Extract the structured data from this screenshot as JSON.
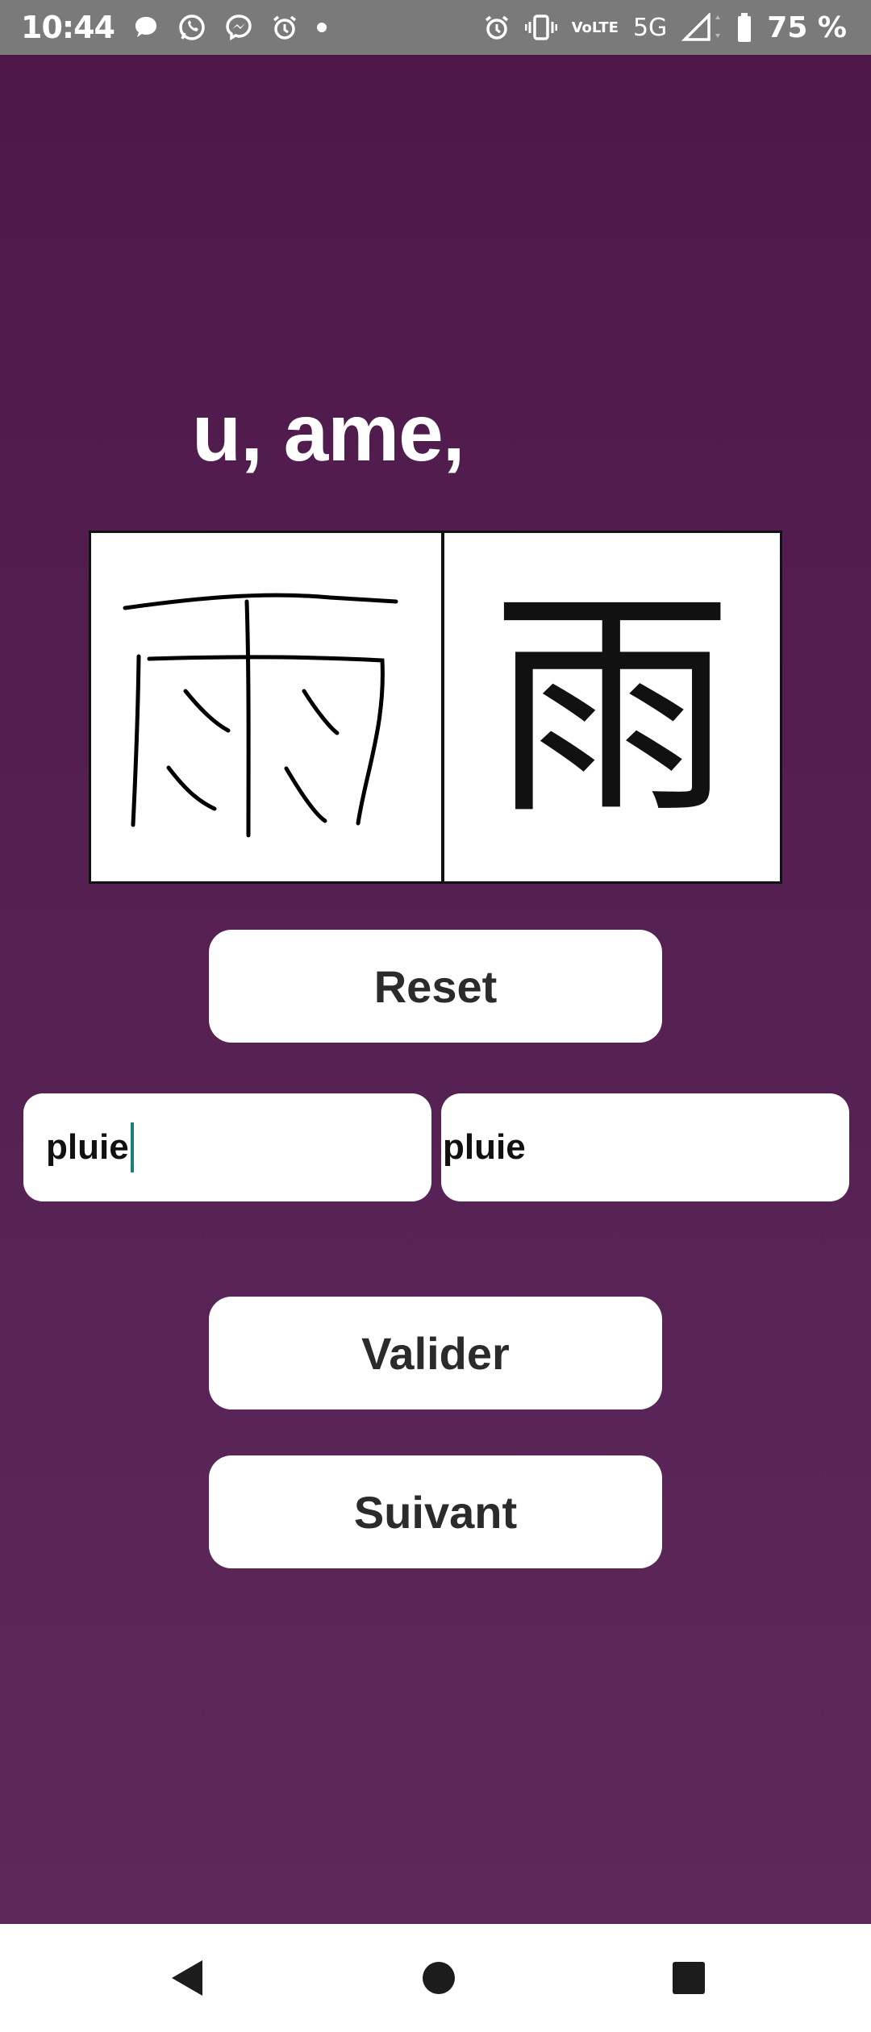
{
  "status_bar": {
    "time": "10:44",
    "network": "5G",
    "volte_top": "Vo",
    "volte_bottom": "LTE",
    "battery": "75 %",
    "notification_icons": [
      "chat-bubble-icon",
      "whatsapp-icon",
      "messenger-icon",
      "alarm-icon",
      "dot-icon"
    ],
    "system_icons": [
      "alarm-icon",
      "vibrate-icon",
      "volte-icon",
      "signal-icon",
      "battery-icon"
    ]
  },
  "card": {
    "reading": "u, ame,",
    "reference_kanji": "雨"
  },
  "buttons": {
    "reset": "Reset",
    "validate": "Valider",
    "next": "Suivant"
  },
  "answer_input": {
    "value": "pluie"
  },
  "expected_answer": {
    "value": "pluie"
  },
  "navigation": {
    "icons": [
      "back-icon",
      "home-icon",
      "recents-icon"
    ]
  },
  "colors": {
    "background_top": "#4d1849",
    "background_bottom": "#5e2a5d",
    "status_bar": "#7a7a7a",
    "caret": "#1a7f74"
  }
}
